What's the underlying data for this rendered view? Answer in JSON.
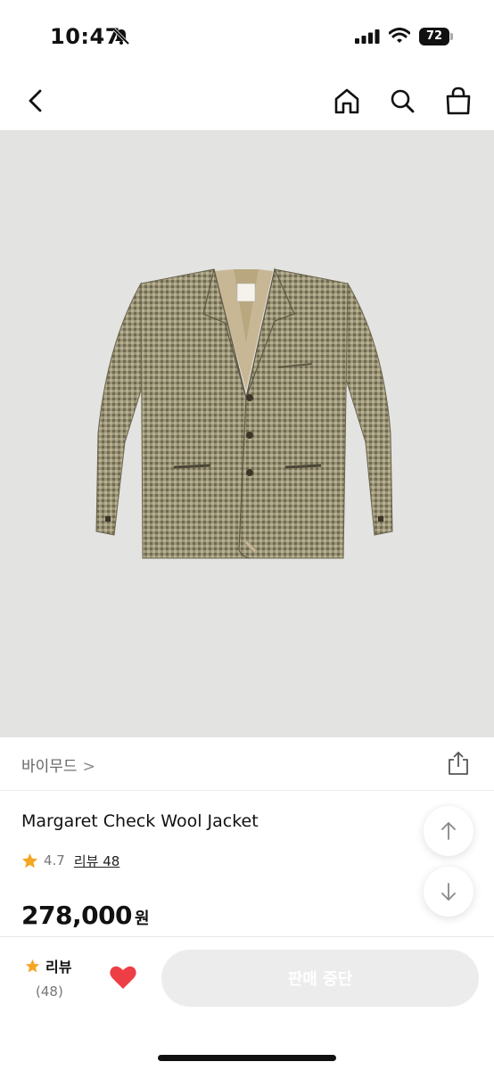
{
  "status_bar": {
    "time": "10:47",
    "battery": "72",
    "icons": [
      "bell-slash-icon",
      "signal-icon",
      "wifi-icon",
      "battery-icon"
    ]
  },
  "nav": {
    "icons": [
      "back-icon",
      "home-icon",
      "search-icon",
      "cart-icon"
    ]
  },
  "product": {
    "image_subject": "check-wool-jacket",
    "brand": "바이무드",
    "brand_chevron": ">",
    "name": "Margaret Check Wool Jacket",
    "rating": "4.7",
    "review_link": "리뷰 48",
    "price": "278,000",
    "currency": "원"
  },
  "bottom_bar": {
    "review_label": "리뷰",
    "review_count": "(48)",
    "sale_button": "판매 중단",
    "favorite": true
  },
  "colors": {
    "star": "#f5a623",
    "heart": "#ee3e45",
    "image_bg": "#e3e3e1",
    "button_disabled": "#ececec"
  }
}
